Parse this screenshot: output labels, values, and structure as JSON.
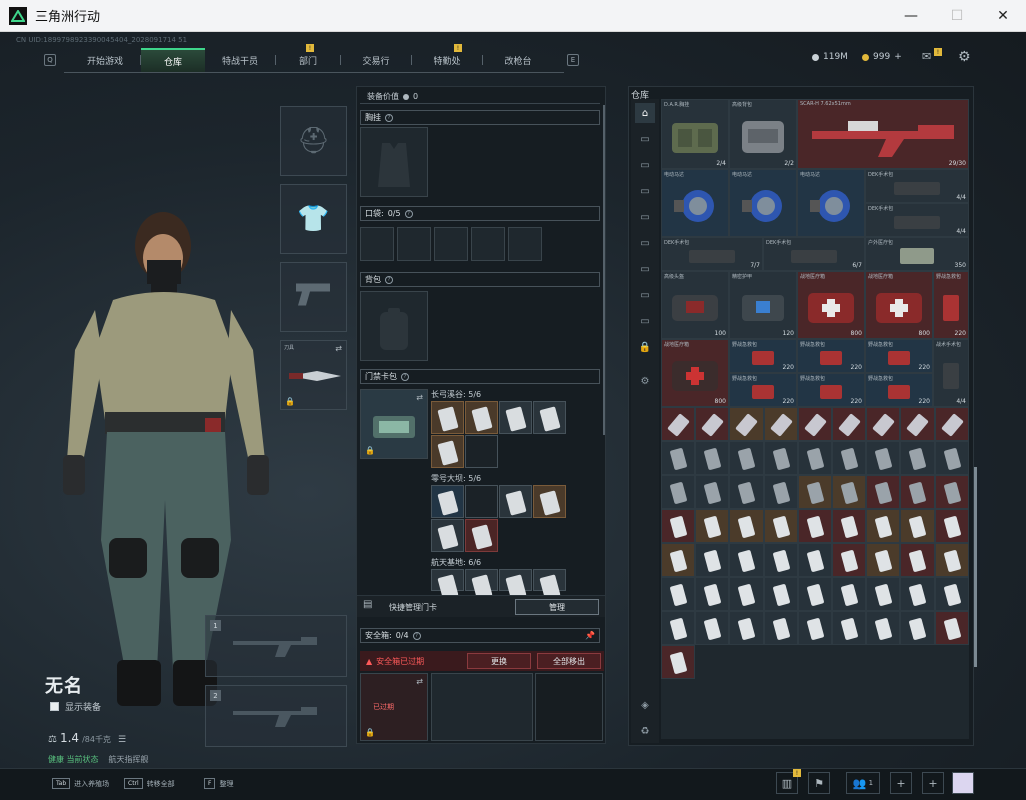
{
  "window": {
    "title": "三角洲行动",
    "minimize": "—",
    "maximize": "☐",
    "close": "✕"
  },
  "uid": "CN UID:1899798923390045404_2028091714 51",
  "nav": {
    "left_key": "Q",
    "right_key": "E",
    "tabs": [
      {
        "label": "开始游戏"
      },
      {
        "label": "仓库",
        "active": true
      },
      {
        "label": "特战干员"
      },
      {
        "label": "部门",
        "badge": "!"
      },
      {
        "label": "交易行"
      },
      {
        "label": "特勤处",
        "badge": "!"
      },
      {
        "label": "改枪台"
      }
    ]
  },
  "currency": {
    "hafcoin": "119M",
    "coupon": "999",
    "plus": "+"
  },
  "character": {
    "name": "无名",
    "show_equipment": "显示装备",
    "weight": "1.4",
    "weight_max": "/84千克",
    "status_a": "健康 当前状态",
    "status_b": "航天指挥舰"
  },
  "slots": {
    "primary_num": "1",
    "secondary_num": "2",
    "melee_label": "刀具"
  },
  "mid": {
    "value_label": "装备价值",
    "value": "0",
    "chest": "胸挂",
    "pockets": "口袋:",
    "pockets_val": "0/5",
    "backpack": "背包",
    "keycard": "门禁卡包",
    "groups": [
      {
        "name": "长弓溪谷: 5/6"
      },
      {
        "name": "零号大坝: 5/6"
      },
      {
        "name": "航天基地: 6/6"
      }
    ],
    "quick_manage": "快捷管理门卡",
    "manage": "管理",
    "safebox": "安全箱:",
    "safebox_val": "0/4",
    "expired_warn": "安全箱已过期",
    "replace": "更换",
    "move_all": "全部移出",
    "expired_tag": "已过期"
  },
  "stash": {
    "title": "仓库",
    "top_items": [
      {
        "label": "D.A.R.胸挂",
        "count": "2/4"
      },
      {
        "label": "高级背包",
        "count": "2/2"
      },
      {
        "label": "SCAR-H 7.62x51mm",
        "count": "29/30"
      }
    ],
    "rows": [
      [
        "电动马达",
        "电动马达",
        "电动马达",
        "DEK手术包"
      ],
      [
        "DEK手术包",
        "DEK手术包",
        "户外医疗包"
      ],
      [
        "高级头盔",
        "精密护甲",
        "战地医疗箱",
        "战地医疗箱",
        "野战急救包"
      ],
      [
        "战地医疗箱",
        "野战急救包",
        "野战急救包",
        "野战急救包",
        "战术手术包"
      ],
      [
        "战术手术包",
        "止血带",
        "注射器",
        "注射器",
        "注射器",
        "注射器"
      ]
    ],
    "counts": {
      "a": "350",
      "b": "120",
      "c": "800",
      "d": "220",
      "e": "4/4",
      "f": "6/7",
      "g": "7/7",
      "h": "100",
      "i": "5/5"
    }
  },
  "bottom": {
    "hints": [
      {
        "key": "Tab",
        "label": "进入养殖场"
      },
      {
        "key": "Ctrl",
        "label": "转移全部"
      },
      {
        "key": "F",
        "label": "整理"
      }
    ],
    "chat_count": "1"
  }
}
